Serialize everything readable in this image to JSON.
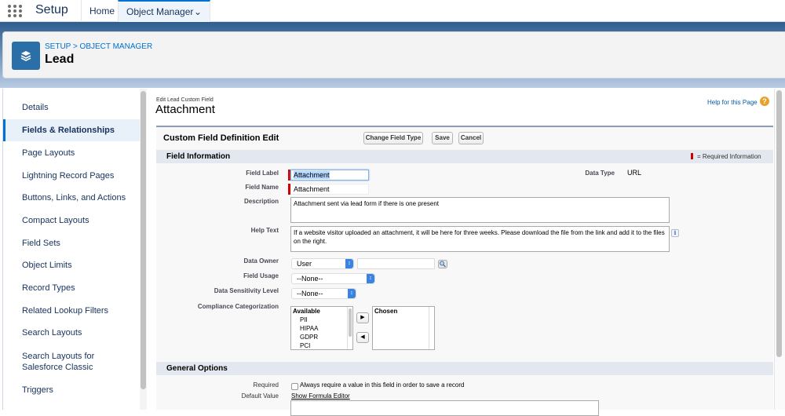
{
  "topbar": {
    "app_name": "Setup",
    "tabs": [
      {
        "label": "Home"
      },
      {
        "label": "Object Manager"
      }
    ]
  },
  "header": {
    "breadcrumb": "SETUP > OBJECT MANAGER",
    "object_name": "Lead"
  },
  "sidebar": {
    "items": [
      {
        "label": "Details"
      },
      {
        "label": "Fields & Relationships"
      },
      {
        "label": "Page Layouts"
      },
      {
        "label": "Lightning Record Pages"
      },
      {
        "label": "Buttons, Links, and Actions"
      },
      {
        "label": "Compact Layouts"
      },
      {
        "label": "Field Sets"
      },
      {
        "label": "Object Limits"
      },
      {
        "label": "Record Types"
      },
      {
        "label": "Related Lookup Filters"
      },
      {
        "label": "Search Layouts"
      },
      {
        "label": "Search Layouts for Salesforce Classic"
      },
      {
        "label": "Triggers"
      }
    ],
    "active": "Fields & Relationships"
  },
  "page": {
    "subtitle": "Edit Lead Custom Field",
    "title": "Attachment",
    "help_link": "Help for this Page"
  },
  "form": {
    "title": "Custom Field Definition Edit",
    "buttons": {
      "change_type": "Change Field Type",
      "save": "Save",
      "cancel": "Cancel"
    },
    "field_info": {
      "section_title": "Field Information",
      "required_note": "= Required Information",
      "field_label_label": "Field Label",
      "field_label_value": "Attachment",
      "field_name_label": "Field Name",
      "field_name_value": "Attachment",
      "data_type_label": "Data Type",
      "data_type_value": "URL",
      "description_label": "Description",
      "description_value": "Attachment sent via lead form if there is one present",
      "help_text_label": "Help Text",
      "help_text_value": "If a website visitor uploaded an attachment, it will be here for three weeks. Please download the file from the link and add it to the files on the right.",
      "data_owner_label": "Data Owner",
      "data_owner_value": "User",
      "data_owner_lookup_value": "",
      "field_usage_label": "Field Usage",
      "field_usage_value": "--None--",
      "sensitivity_label": "Data Sensitivity Level",
      "sensitivity_value": "--None--",
      "compliance_label": "Compliance Categorization",
      "available_header": "Available",
      "available_options": [
        "PII",
        "HIPAA",
        "GDPR",
        "PCI"
      ],
      "chosen_header": "Chosen",
      "add_arrow": "▶",
      "remove_arrow": "◀"
    },
    "general_options": {
      "section_title": "General Options",
      "required_label": "Required",
      "required_checkbox_text": "Always require a value in this field in order to save a record",
      "required_checked": false,
      "default_value_label": "Default Value",
      "formula_editor_link": "Show Formula Editor",
      "default_value": ""
    }
  },
  "colors": {
    "accent": "#0070d2",
    "object_icon": "#2a6fa8",
    "required": "#cc0000",
    "help_icon": "#e8a12a"
  }
}
